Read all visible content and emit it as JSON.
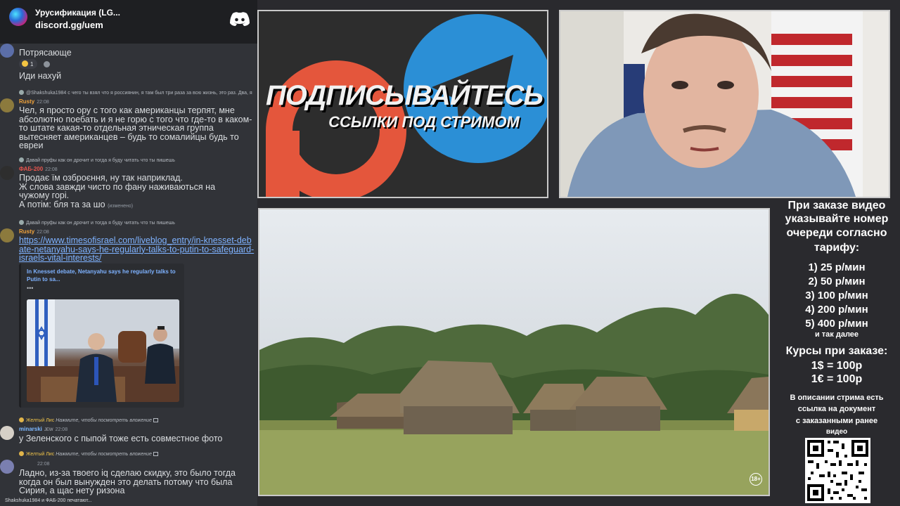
{
  "server": {
    "name": "Урусификация (LG...",
    "invite": "discord.gg/uem"
  },
  "messages": [
    {
      "text": "Потрясающе",
      "reaction": {
        "emoji": "laughing-face",
        "count": "1"
      }
    },
    {
      "text": "Иди нахуй"
    },
    {
      "reply": "@Shakshuka1984 с чего ты взял что я россиянин, я там был три раза за всю жизнь, это раз. Два, я",
      "author": "Rusty",
      "time": "22:08",
      "text": "Чел, я просто ору с того как американцы терпят, мне абсолютно поебать и я не горю с того что где-то в каком-то штате какая-то отдельная этническая группа вытесняет американцев – будь то сомалийцы будь то евреи"
    },
    {
      "reply": "Давай пруфы как он дрочит и тогда я буду читать что ты пишешь",
      "author": "ФАБ-200",
      "time": "22:08",
      "lines": [
        "Продає їм озброєння, ну так наприклад.",
        "Ж слова завжди чисто по фану наживаються на",
        "чужому горі."
      ],
      "last_line": "А потім: бля та за шо",
      "edited": "(изменено)"
    },
    {
      "reply": "Давай пруфы как он дрочит и тогда я буду читать что ты пишешь",
      "author": "Rusty",
      "time": "22:08",
      "link": "https://www.timesofisrael.com/liveblog_entry/in-knesset-debate-netanyahu-says-he-regularly-talks-to-putin-to-safeguard-israels-vital-interests/",
      "embed": {
        "title": "In Knesset debate, Netanyahu says he regularly talks to Putin to sa...",
        "dots": "•••"
      }
    },
    {
      "reply_user": "Желтый Лис",
      "reply": "Нажмите, чтобы посмотреть вложение",
      "author": "minarski",
      "badge": "JEW",
      "time": "22:08",
      "text": "у Зеленского с пыпой тоже есть совместное фото"
    },
    {
      "reply_user": "Желтый Лис",
      "reply": "Нажмите, чтобы посмотреть вложение",
      "time": "22:08",
      "text": "Ладно, из-за твоего iq сделаю скидку, это было тогда когда он был вынужден это делать потому что была Сирия, а щас нету ризона"
    }
  ],
  "typing": "Shakshuka1984 и ФАБ-200 печатают...",
  "promo": {
    "title": "ПОДПИСЫВАЙТЕСЬ",
    "subtitle": "ССЫЛКИ ПОД СТРИМОМ"
  },
  "video": {
    "age_rating": "18+"
  },
  "info": {
    "order_heading": [
      "При заказе видео",
      "указывайте номер",
      "очереди согласно",
      "тарифу:"
    ],
    "tariffs": [
      "1) 25 р/мин",
      "2) 50 р/мин",
      "3) 100 р/мин",
      "4) 200 р/мин",
      "5) 400 р/мин"
    ],
    "tariffs_more": "и так далее",
    "rates_heading": "Курсы при заказе:",
    "rates": [
      "1$ = 100р",
      "1€ = 100р"
    ],
    "description": [
      "В описании стрима есть",
      "ссылка на документ",
      "с заказанными ранее",
      "видео"
    ]
  },
  "colors": {
    "discord_bg": "#313338",
    "header_bg": "#1e1f22",
    "link": "#7eb2ff",
    "author_rusty": "#f1a33b",
    "author_fab": "#e8554e",
    "author_minarski": "#7db8ff",
    "patreon": "#e4563c",
    "telegram": "#2b8fd6"
  }
}
